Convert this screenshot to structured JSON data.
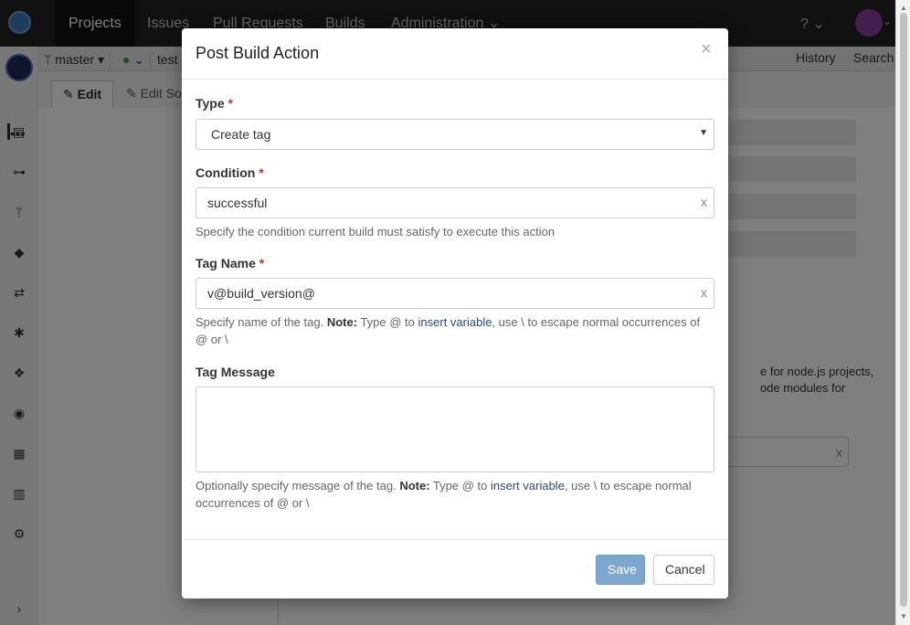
{
  "topbar": {
    "nav": [
      "Projects",
      "Issues",
      "Pull Requests",
      "Builds",
      "Administration"
    ],
    "admin_caret": "⌄",
    "help_icon": "?"
  },
  "subbar": {
    "branch": "master",
    "status_text": "test",
    "history": "History",
    "search": "Search"
  },
  "tabs": {
    "edit": "Edit",
    "edit_source": "Edit So"
  },
  "background": {
    "text_lines": [
      "e for node.js projects,",
      "ode modules for"
    ],
    "input_clear": "x"
  },
  "modal": {
    "title": "Post Build Action",
    "close": "×",
    "type": {
      "label": "Type",
      "required": "*",
      "value": "Create tag"
    },
    "condition": {
      "label": "Condition",
      "required": "*",
      "value": "successful",
      "clear": "x",
      "help": "Specify the condition current build must satisfy to execute this action"
    },
    "tag_name": {
      "label": "Tag Name",
      "required": "*",
      "value": "v@build_version@",
      "clear": "x",
      "help_pre": "Specify name of the tag.",
      "help_note": "Note:",
      "help_mid": "Type @ to",
      "help_link": "insert variable",
      "help_post": ", use \\ to escape normal occurrences of @ or \\"
    },
    "tag_message": {
      "label": "Tag Message",
      "value": "",
      "help_pre": "Optionally specify message of the tag.",
      "help_note": "Note:",
      "help_mid": "Type @ to",
      "help_link": "insert variable",
      "help_post": ", use \\ to escape normal occurrences of @ or \\"
    },
    "save": "Save",
    "cancel": "Cancel"
  }
}
